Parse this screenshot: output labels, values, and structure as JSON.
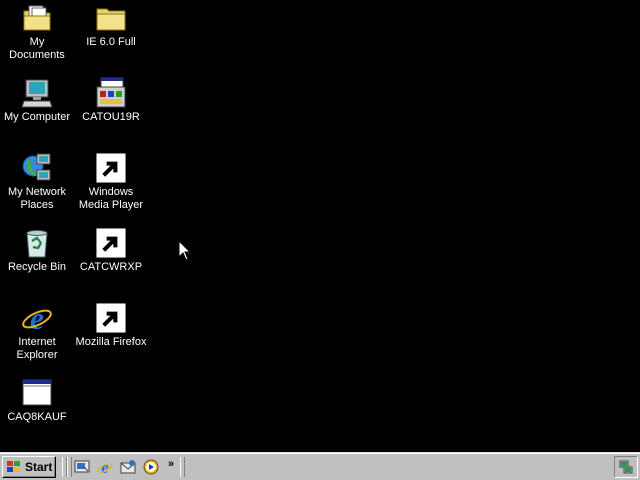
{
  "desktop": {
    "icons": [
      {
        "label": "My Documents",
        "icon": "folder-documents-icon"
      },
      {
        "label": "IE 6.0 Full",
        "icon": "folder-icon"
      },
      {
        "label": "My Computer",
        "icon": "computer-icon"
      },
      {
        "label": "CATOU19R",
        "icon": "program-window-icon"
      },
      {
        "label": "My Network Places",
        "icon": "network-places-icon"
      },
      {
        "label": "Windows Media Player",
        "icon": "media-player-icon"
      },
      {
        "label": "Recycle Bin",
        "icon": "recycle-bin-icon"
      },
      {
        "label": "CATCWRXP",
        "icon": "cd-installer-icon"
      },
      {
        "label": "Internet Explorer",
        "icon": "internet-explorer-icon"
      },
      {
        "label": "Mozilla Firefox",
        "icon": "firefox-icon"
      },
      {
        "label": "CAQ8KAUF",
        "icon": "blank-window-icon"
      }
    ]
  },
  "taskbar": {
    "start_label": "Start",
    "quick_launch": [
      "show-desktop-icon",
      "internet-explorer-icon",
      "outlook-express-icon",
      "media-player-icon"
    ],
    "more_label": "»",
    "tray_icon": "network-tray-icon"
  },
  "colors": {
    "desktop_background": "#000000",
    "taskbar": "#c0c0c0",
    "label_text": "#ffffff"
  }
}
